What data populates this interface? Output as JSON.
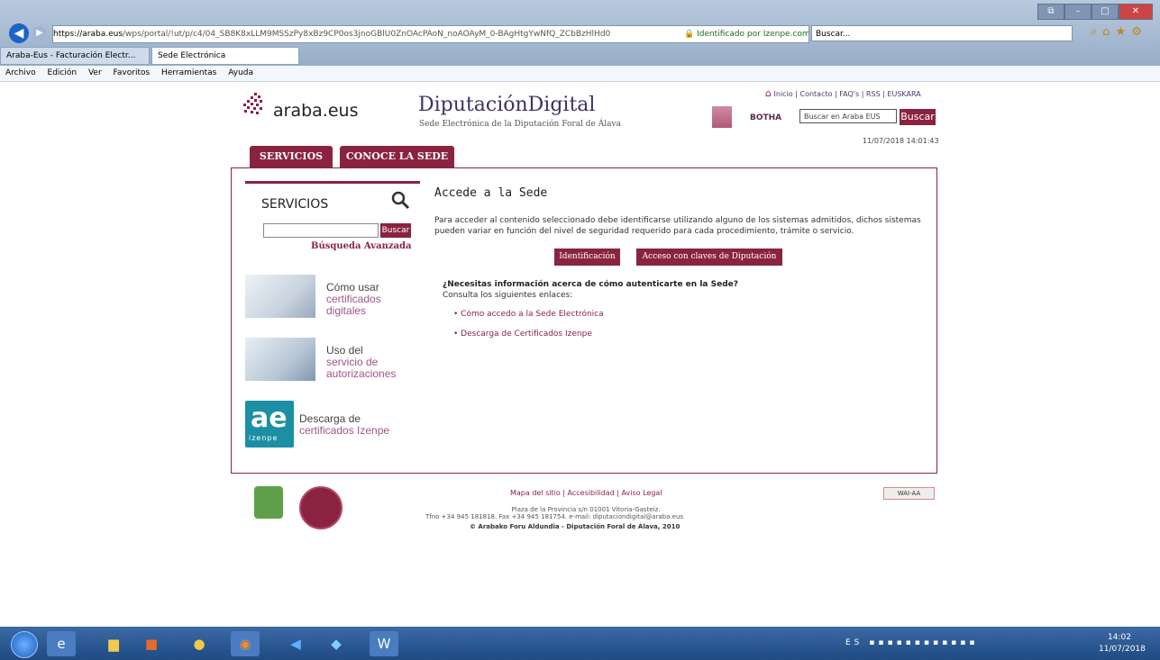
{
  "browser": {
    "address_scheme": "https://",
    "address_host": "araba.eus",
    "address_path": "/wps/portal/!ut/p/c4/04_SB8K8xLLM9MSSzPy8xBz9CP0os3jnoGBlU0ZnOAcPAoN_noAOAyM_0-BAgHtgYwNfQ_ZCbBzHlHd0",
    "security_label": "Identificado por Izenpe.com",
    "search_placeholder": "Buscar...",
    "tabs": [
      {
        "label": "Araba-Eus - Facturación Electr..."
      },
      {
        "label": "Sede Electrónica"
      }
    ],
    "menu": [
      "Archivo",
      "Edición",
      "Ver",
      "Favoritos",
      "Herramientas",
      "Ayuda"
    ]
  },
  "header": {
    "logo_text": "araba.eus",
    "title": "DiputaciónDigital",
    "subtitle": "Sede Electrónica de la Diputación Foral de Álava",
    "top_links": "Inicio | Contacto | FAQ's | RSS | EUSKARA",
    "botha": "BOTHA",
    "search_placeholder": "Buscar en Araba EUS",
    "search_button": "Buscar",
    "datetime": "11/07/2018 14:01:43"
  },
  "nav": {
    "servicios": "SERVICIOS",
    "conoce": "CONOCE LA SEDE"
  },
  "sidebar": {
    "title": "SERVICIOS",
    "search_button": "Buscar",
    "advanced": "Búsqueda Avanzada",
    "promos": [
      {
        "line1": "Cómo usar",
        "line2": "certificados",
        "line3": "digitales"
      },
      {
        "line1": "Uso del",
        "line2": "servicio de",
        "line3": "autorizaciones"
      },
      {
        "line1": "Descarga de",
        "line2": "certificados Izenpe",
        "line3": ""
      }
    ],
    "izenpe_logo": "ae",
    "izenpe_word": "izenpe"
  },
  "main": {
    "title": "Accede a la Sede",
    "text": "Para acceder al contenido seleccionado debe identificarse utilizando alguno de los sistemas admitidos, dichos sistemas pueden variar en función del nivel de seguridad requerido para cada procedimiento, trámite o servicio.",
    "btn_ident": "Identificación",
    "btn_claves": "Acceso con claves de Diputación",
    "info_question": "¿Necesitas información acerca de cómo autenticarte en la Sede?",
    "info_sub": "Consulta los siguientes enlaces:",
    "links": [
      "Cómo accedo a la Sede Electrónica",
      "Descarga de Certificados Izenpe"
    ]
  },
  "footer": {
    "links": "Mapa del sitio  | Accesibilidad  |  Aviso Legal",
    "address": "Plaza de la Provincia s/n 01001 Vitoria-Gasteiz.",
    "tel": "Tfno +34 945 181818. Fax +34 945 181754. e-mail: diputaciondigital@araba.eus",
    "copyright": "© Arabako Foru Aldundia - Diputación Foral de Álava, 2010",
    "wai": "WAI-AA"
  },
  "taskbar": {
    "tray_lang": "ES",
    "time": "14:02",
    "date": "11/07/2018"
  },
  "colors": {
    "accent": "#8a2340"
  }
}
